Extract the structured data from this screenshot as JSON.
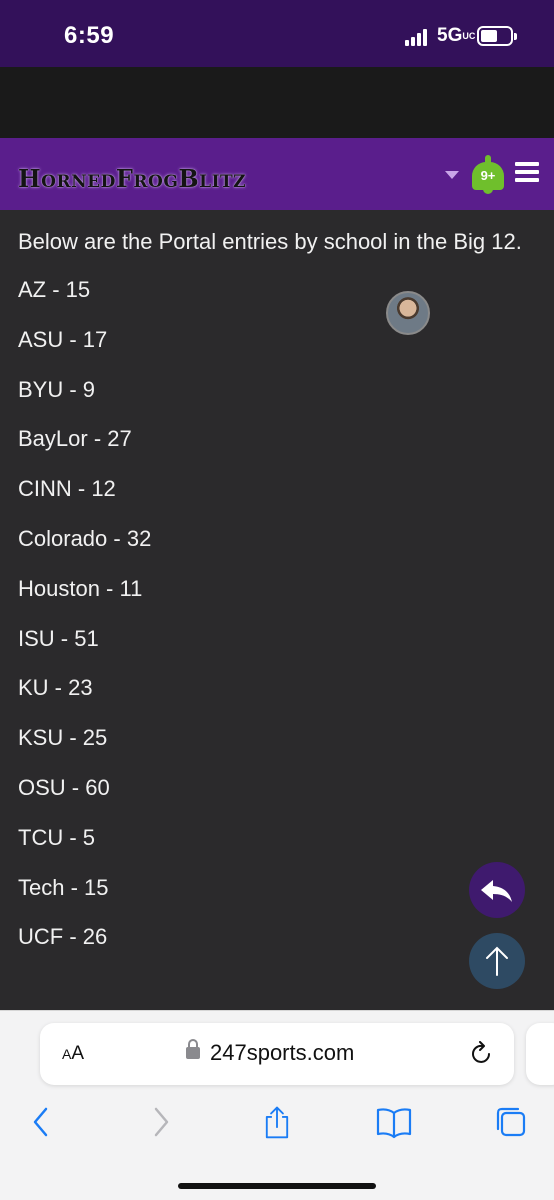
{
  "status_bar": {
    "time": "6:59",
    "network": "5G",
    "network_suffix": "UC"
  },
  "site_header": {
    "logo_text": "HornedFrogBlitz",
    "notification_badge": "9+"
  },
  "post": {
    "intro": "Below are the Portal entries by school in the Big 12.",
    "entries": [
      "AZ - 15",
      "ASU - 17",
      "BYU - 9",
      "BayLor - 27",
      "CINN - 12",
      "Colorado - 32",
      "Houston - 11",
      "ISU - 51",
      "KU - 23",
      "KSU - 25",
      "OSU - 60",
      "TCU - 5",
      "Tech - 15",
      "UCF - 26"
    ]
  },
  "browser": {
    "text_size_label": "AA",
    "url": "247sports.com"
  },
  "colors": {
    "status_bar": "#33115a",
    "site_header": "#5a1e8c",
    "content_bg": "#2b2a2c",
    "badge": "#6fbf2c",
    "safari_blue": "#1a7cf5"
  },
  "icons": [
    "signal-icon",
    "battery-icon",
    "caret-down-icon",
    "bell-icon",
    "menu-icon",
    "reply-icon",
    "arrow-up-icon",
    "lock-icon",
    "reload-icon",
    "back-icon",
    "forward-icon",
    "share-icon",
    "bookmarks-icon",
    "tabs-icon"
  ]
}
